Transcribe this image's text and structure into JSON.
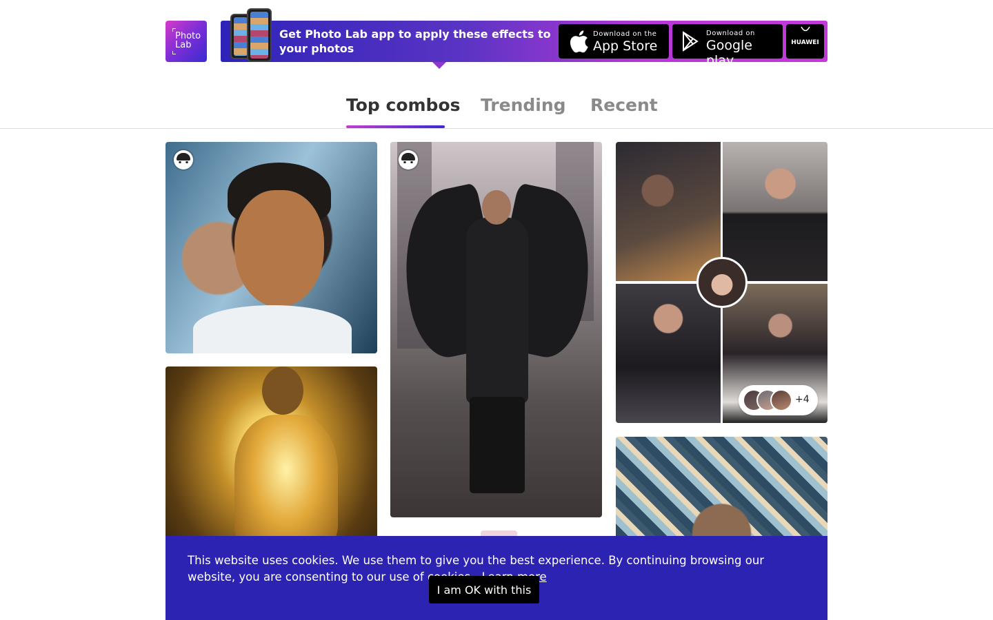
{
  "logo": {
    "line1": "Photo",
    "line2": "Lab"
  },
  "banner": {
    "text": "Get Photo Lab app to apply these effects to your photos",
    "apple": {
      "small": "Download on the",
      "big": "App Store"
    },
    "google": {
      "small": "Download on",
      "big": "Google play"
    },
    "huawei": {
      "label": "HUAWEI"
    }
  },
  "tabs": [
    {
      "label": "Top combos",
      "active": true
    },
    {
      "label": "Trending",
      "active": false
    },
    {
      "label": "Recent",
      "active": false
    }
  ],
  "grid": {
    "collage_more": "+4"
  },
  "cookie": {
    "text": "This website uses cookies. We use them to give you the best experience. By continuing browsing our website, you are consenting to our use of cookies.",
    "link": "Learn more",
    "button": "I am OK with this"
  },
  "colors": {
    "accent_blue": "#2d23b2",
    "accent_pink": "#c13fcf",
    "button_black": "#000000"
  }
}
